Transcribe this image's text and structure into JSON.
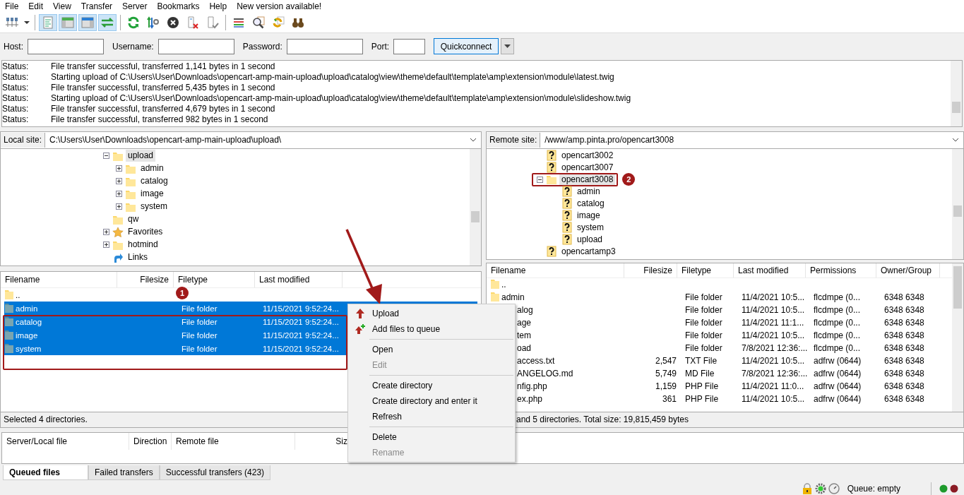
{
  "menu_bar": [
    "File",
    "Edit",
    "View",
    "Transfer",
    "Server",
    "Bookmarks",
    "Help",
    "New version available!"
  ],
  "toolbar": [
    {
      "kind": "site-manager"
    },
    {
      "kind": "caret"
    },
    {
      "kind": "separator"
    },
    {
      "kind": "message-log",
      "on": true
    },
    {
      "kind": "local-tree",
      "on": true
    },
    {
      "kind": "remote-tree",
      "on": true
    },
    {
      "kind": "queue",
      "on": true
    },
    {
      "kind": "separator"
    },
    {
      "kind": "refresh"
    },
    {
      "kind": "process-queue"
    },
    {
      "kind": "cancel"
    },
    {
      "kind": "disconnect"
    },
    {
      "kind": "reconnect"
    },
    {
      "kind": "separator"
    },
    {
      "kind": "filter"
    },
    {
      "kind": "compare"
    },
    {
      "kind": "sync"
    },
    {
      "kind": "find"
    }
  ],
  "quickconnect": {
    "fields": [
      {
        "label": "Host:"
      },
      {
        "label": "Username:"
      },
      {
        "label": "Password:"
      },
      {
        "label": "Port:"
      }
    ],
    "button": "Quickconnect"
  },
  "log": [
    {
      "label": "Status:",
      "text": "File transfer successful, transferred 1,141 bytes in 1 second"
    },
    {
      "label": "Status:",
      "text": "Starting upload of C:\\Users\\User\\Downloads\\opencart-amp-main-upload\\upload\\catalog\\view\\theme\\default\\template\\amp\\extension\\module\\latest.twig"
    },
    {
      "label": "Status:",
      "text": "File transfer successful, transferred 5,435 bytes in 1 second"
    },
    {
      "label": "Status:",
      "text": "Starting upload of C:\\Users\\User\\Downloads\\opencart-amp-main-upload\\upload\\catalog\\view\\theme\\default\\template\\amp\\extension\\module\\slideshow.twig"
    },
    {
      "label": "Status:",
      "text": "File transfer successful, transferred 4,679 bytes in 1 second"
    },
    {
      "label": "Status:",
      "text": "File transfer successful, transferred 982 bytes in 1 second"
    }
  ],
  "local": {
    "site_label": "Local site:",
    "path": "C:\\Users\\User\\Downloads\\opencart-amp-main-upload\\upload\\",
    "tree": [
      {
        "name": "upload",
        "kind": "folder",
        "selected": true,
        "expanded": true,
        "children": [
          {
            "name": "admin",
            "kind": "folder",
            "selected": false,
            "expanded": false
          },
          {
            "name": "catalog",
            "kind": "folder",
            "selected": false,
            "expanded": false
          },
          {
            "name": "image",
            "kind": "folder",
            "selected": false,
            "expanded": false
          },
          {
            "name": "system",
            "kind": "folder",
            "selected": false,
            "expanded": false
          }
        ]
      },
      {
        "name": "qw",
        "kind": "folder",
        "selected": false
      },
      {
        "name": "Favorites",
        "kind": "star",
        "selected": false,
        "expanded": false
      },
      {
        "name": "hotmind",
        "kind": "folder",
        "selected": false,
        "expanded": false
      },
      {
        "name": "Links",
        "kind": "link",
        "selected": false
      }
    ],
    "columns": [
      "Filename",
      "Filesize",
      "Filetype",
      "Last modified"
    ],
    "rows": [
      {
        "kind": "folder",
        "selected": false,
        "cells": [
          "..",
          "",
          "",
          ""
        ]
      },
      {
        "kind": "folder",
        "selected": true,
        "cells": [
          "admin",
          "",
          "File folder",
          "11/15/2021 9:52:24..."
        ]
      },
      {
        "kind": "folder",
        "selected": true,
        "cells": [
          "catalog",
          "",
          "File folder",
          "11/15/2021 9:52:24..."
        ]
      },
      {
        "kind": "folder",
        "selected": true,
        "cells": [
          "image",
          "",
          "File folder",
          "11/15/2021 9:52:24..."
        ]
      },
      {
        "kind": "folder",
        "selected": true,
        "cells": [
          "system",
          "",
          "File folder",
          "11/15/2021 9:52:24..."
        ]
      }
    ],
    "callout": "1",
    "status": "Selected 4 directories."
  },
  "remote": {
    "site_label": "Remote site:",
    "path": "/www/amp.pinta.pro/opencart3008",
    "tree": [
      {
        "name": "opencart3002",
        "kind": "unknown",
        "selected": false
      },
      {
        "name": "opencart3007",
        "kind": "unknown",
        "selected": false
      },
      {
        "name": "opencart3008",
        "kind": "folder",
        "selected": true,
        "expanded": true,
        "callout": "2",
        "children": [
          {
            "name": "admin",
            "kind": "unknown",
            "selected": false
          },
          {
            "name": "catalog",
            "kind": "unknown",
            "selected": false
          },
          {
            "name": "image",
            "kind": "unknown",
            "selected": false
          },
          {
            "name": "system",
            "kind": "unknown",
            "selected": false
          },
          {
            "name": "upload",
            "kind": "unknown",
            "selected": false
          }
        ]
      },
      {
        "name": "opencartamp3",
        "kind": "unknown",
        "selected": false
      }
    ],
    "columns": [
      "Filename",
      "Filesize",
      "Filetype",
      "Last modified",
      "Permissions",
      "Owner/Group"
    ],
    "rows": [
      {
        "kind": "folder",
        "selected": false,
        "cells": [
          "..",
          "",
          "",
          "",
          "",
          ""
        ]
      },
      {
        "kind": "folder",
        "selected": false,
        "cells": [
          "admin",
          "",
          "File folder",
          "11/4/2021 10:5...",
          "flcdmpe (0...",
          "6348 6348"
        ]
      },
      {
        "kind": "cut",
        "selected": false,
        "cells": [
          "alog",
          "",
          "File folder",
          "11/4/2021 10:5...",
          "flcdmpe (0...",
          "6348 6348"
        ]
      },
      {
        "kind": "cut",
        "selected": false,
        "cells": [
          "age",
          "",
          "File folder",
          "11/4/2021 11:1...",
          "flcdmpe (0...",
          "6348 6348"
        ]
      },
      {
        "kind": "cut",
        "selected": false,
        "cells": [
          "tem",
          "",
          "File folder",
          "11/4/2021 10:5...",
          "flcdmpe (0...",
          "6348 6348"
        ]
      },
      {
        "kind": "cut",
        "selected": false,
        "cells": [
          "oad",
          "",
          "File folder",
          "7/8/2021 12:36:...",
          "flcdmpe (0...",
          "6348 6348"
        ]
      },
      {
        "kind": "cut",
        "selected": false,
        "cells": [
          "access.txt",
          "2,547",
          "TXT File",
          "11/4/2021 10:5...",
          "adfrw (0644)",
          "6348 6348"
        ]
      },
      {
        "kind": "cut",
        "selected": false,
        "cells": [
          "ANGELOG.md",
          "5,749",
          "MD File",
          "7/8/2021 12:36:...",
          "adfrw (0644)",
          "6348 6348"
        ]
      },
      {
        "kind": "cut",
        "selected": false,
        "cells": [
          "nfig.php",
          "1,159",
          "PHP File",
          "11/4/2021 11:0...",
          "adfrw (0644)",
          "6348 6348"
        ]
      },
      {
        "kind": "cut",
        "selected": false,
        "cells": [
          "ex.php",
          "361",
          "PHP File",
          "11/4/2021 10:5...",
          "adfrw (0644)",
          "6348 6348"
        ]
      }
    ],
    "status": "and 5 directories. Total size: 19,815,459 bytes"
  },
  "queue": {
    "columns": [
      "Server/Local file",
      "Direction",
      "Remote file",
      "Siz"
    ]
  },
  "queue_tabs": [
    {
      "label": "Queued files",
      "selected": true
    },
    {
      "label": "Failed transfers",
      "selected": false
    },
    {
      "label": "Successful transfers (423)",
      "selected": false
    }
  ],
  "status_bar": {
    "queue": "Queue: empty"
  },
  "context_menu": [
    {
      "kind": "upload",
      "label": "Upload",
      "disabled": false
    },
    {
      "kind": "add-queue",
      "label": "Add files to queue",
      "disabled": false
    },
    {
      "kind": "separator"
    },
    {
      "kind": "plain",
      "label": "Open",
      "disabled": false
    },
    {
      "kind": "plain",
      "label": "Edit",
      "disabled": true
    },
    {
      "kind": "separator"
    },
    {
      "kind": "plain",
      "label": "Create directory",
      "disabled": false
    },
    {
      "kind": "plain",
      "label": "Create directory and enter it",
      "disabled": false
    },
    {
      "kind": "plain",
      "label": "Refresh",
      "disabled": false
    },
    {
      "kind": "separator"
    },
    {
      "kind": "plain",
      "label": "Delete",
      "disabled": false
    },
    {
      "kind": "plain",
      "label": "Rename",
      "disabled": true
    }
  ]
}
